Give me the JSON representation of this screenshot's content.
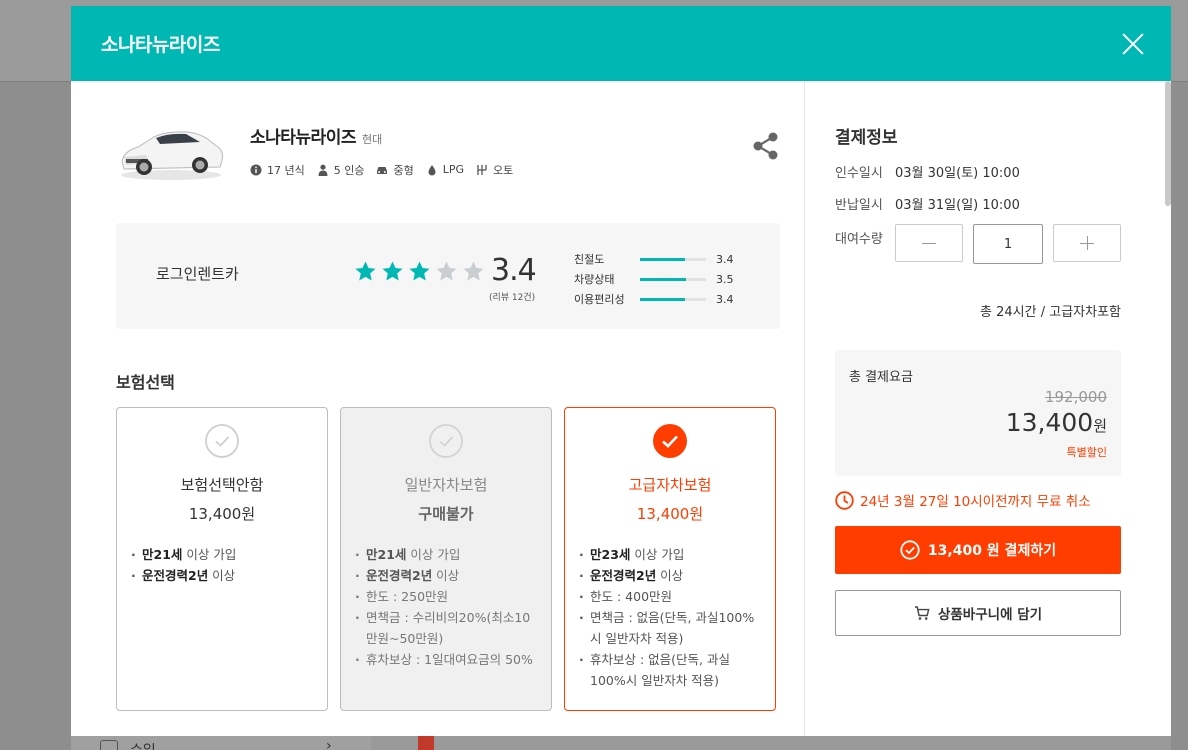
{
  "background": {
    "side_label": "수입",
    "chevron_glyph": "›"
  },
  "modal": {
    "title": "소나타뉴라이즈"
  },
  "car": {
    "name": "소나타뉴라이즈",
    "brand": "현대",
    "specs": {
      "year": "17 년식",
      "seats": "5 인승",
      "size": "중형",
      "fuel": "LPG",
      "transmission": "오토"
    }
  },
  "rating": {
    "company": "로그인렌트카",
    "stars_filled": 3,
    "stars_total": 5,
    "score": "3.4",
    "review_count": "(리뷰 12건)",
    "metrics": [
      {
        "label": "친절도",
        "value": "3.4",
        "fraction": 0.68
      },
      {
        "label": "차량상태",
        "value": "3.5",
        "fraction": 0.7
      },
      {
        "label": "이용편리성",
        "value": "3.4",
        "fraction": 0.68
      }
    ],
    "accent_color": "#00b8b3"
  },
  "insurance": {
    "title": "보험선택",
    "options": [
      {
        "name": "보험선택안함",
        "price": "13,400원",
        "state": "default",
        "items": [
          {
            "bold": "만21세",
            "text": " 이상 가입"
          },
          {
            "bold": "운전경력2년",
            "text": " 이상"
          }
        ]
      },
      {
        "name": "일반자차보험",
        "price": "구매불가",
        "state": "disabled",
        "items": [
          {
            "bold": "만21세",
            "text": " 이상 가입"
          },
          {
            "bold": "운전경력2년",
            "text": " 이상"
          },
          {
            "bold": "",
            "text": "한도 : 250만원"
          },
          {
            "bold": "",
            "text": "면책금 : 수리비의20%(최소10만원~50만원)"
          },
          {
            "bold": "",
            "text": "휴차보상 : 1일대여요금의 50%"
          }
        ]
      },
      {
        "name": "고급자차보험",
        "price": "13,400원",
        "state": "selected",
        "items": [
          {
            "bold": "만23세",
            "text": " 이상 가입"
          },
          {
            "bold": "운전경력2년",
            "text": " 이상"
          },
          {
            "bold": "",
            "text": "한도 : 400만원"
          },
          {
            "bold": "",
            "text": "면책금 : 없음(단독, 과실100%시 일반자차 적용)"
          },
          {
            "bold": "",
            "text": "휴차보상 : 없음(단독, 과실100%시 일반자차 적용)"
          }
        ]
      }
    ]
  },
  "payment": {
    "title": "결제정보",
    "pickup_label": "인수일시",
    "pickup_value": "03월 30일(토) 10:00",
    "return_label": "반납일시",
    "return_value": "03월 31일(일) 10:00",
    "qty_label": "대여수량",
    "qty_value": "1",
    "total_hours": "총 24시간 / 고급자차포함",
    "total_label": "총 결제요금",
    "original_price": "192,000",
    "final_price": "13,400",
    "final_unit": "원",
    "discount_label": "특별할인",
    "cancel_note": "24년 3월 27일 10시이전까지 무료 취소",
    "pay_button": "13,400 원 결제하기",
    "cart_button": "상품바구니에 담기",
    "accent_color": "#ff3d00"
  }
}
